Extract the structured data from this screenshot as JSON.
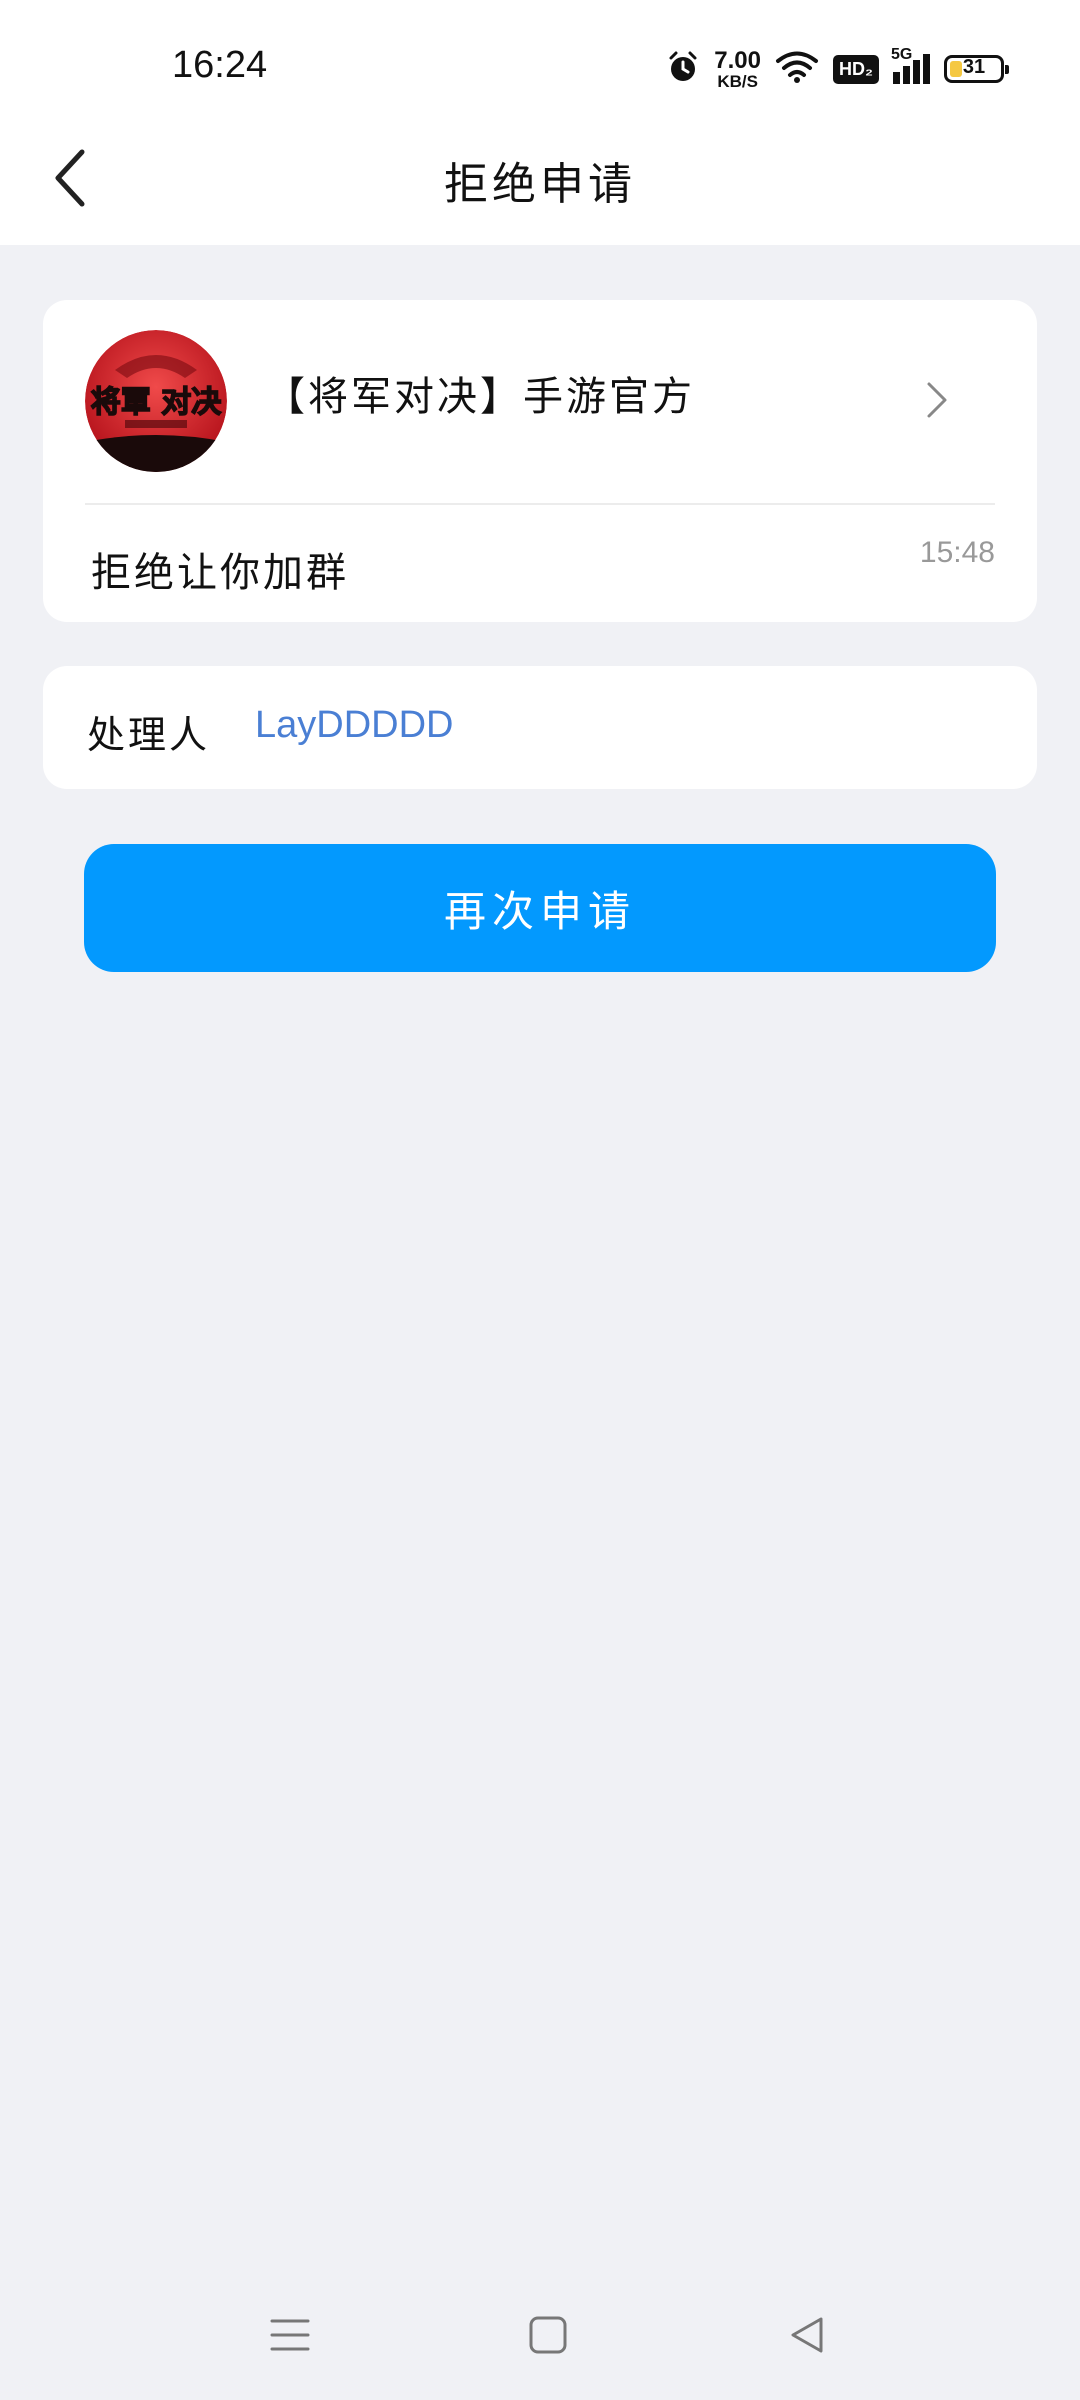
{
  "status": {
    "time": "16:24",
    "net_speed_value": "7.00",
    "net_speed_unit": "KB/S",
    "hd_label": "HD₂",
    "signal_label": "5G",
    "battery_level": "31"
  },
  "header": {
    "title": "拒绝申请"
  },
  "group": {
    "avatar_text": "将軍 对决",
    "name": "【将军对决】手游官方",
    "message": "拒绝让你加群",
    "time": "15:48"
  },
  "handler": {
    "label": "处理人",
    "name": "LayDDDDD"
  },
  "actions": {
    "reapply_label": "再次申请"
  },
  "colors": {
    "accent": "#0399fe",
    "link": "#4a7fd4",
    "background": "#f0f1f5"
  }
}
